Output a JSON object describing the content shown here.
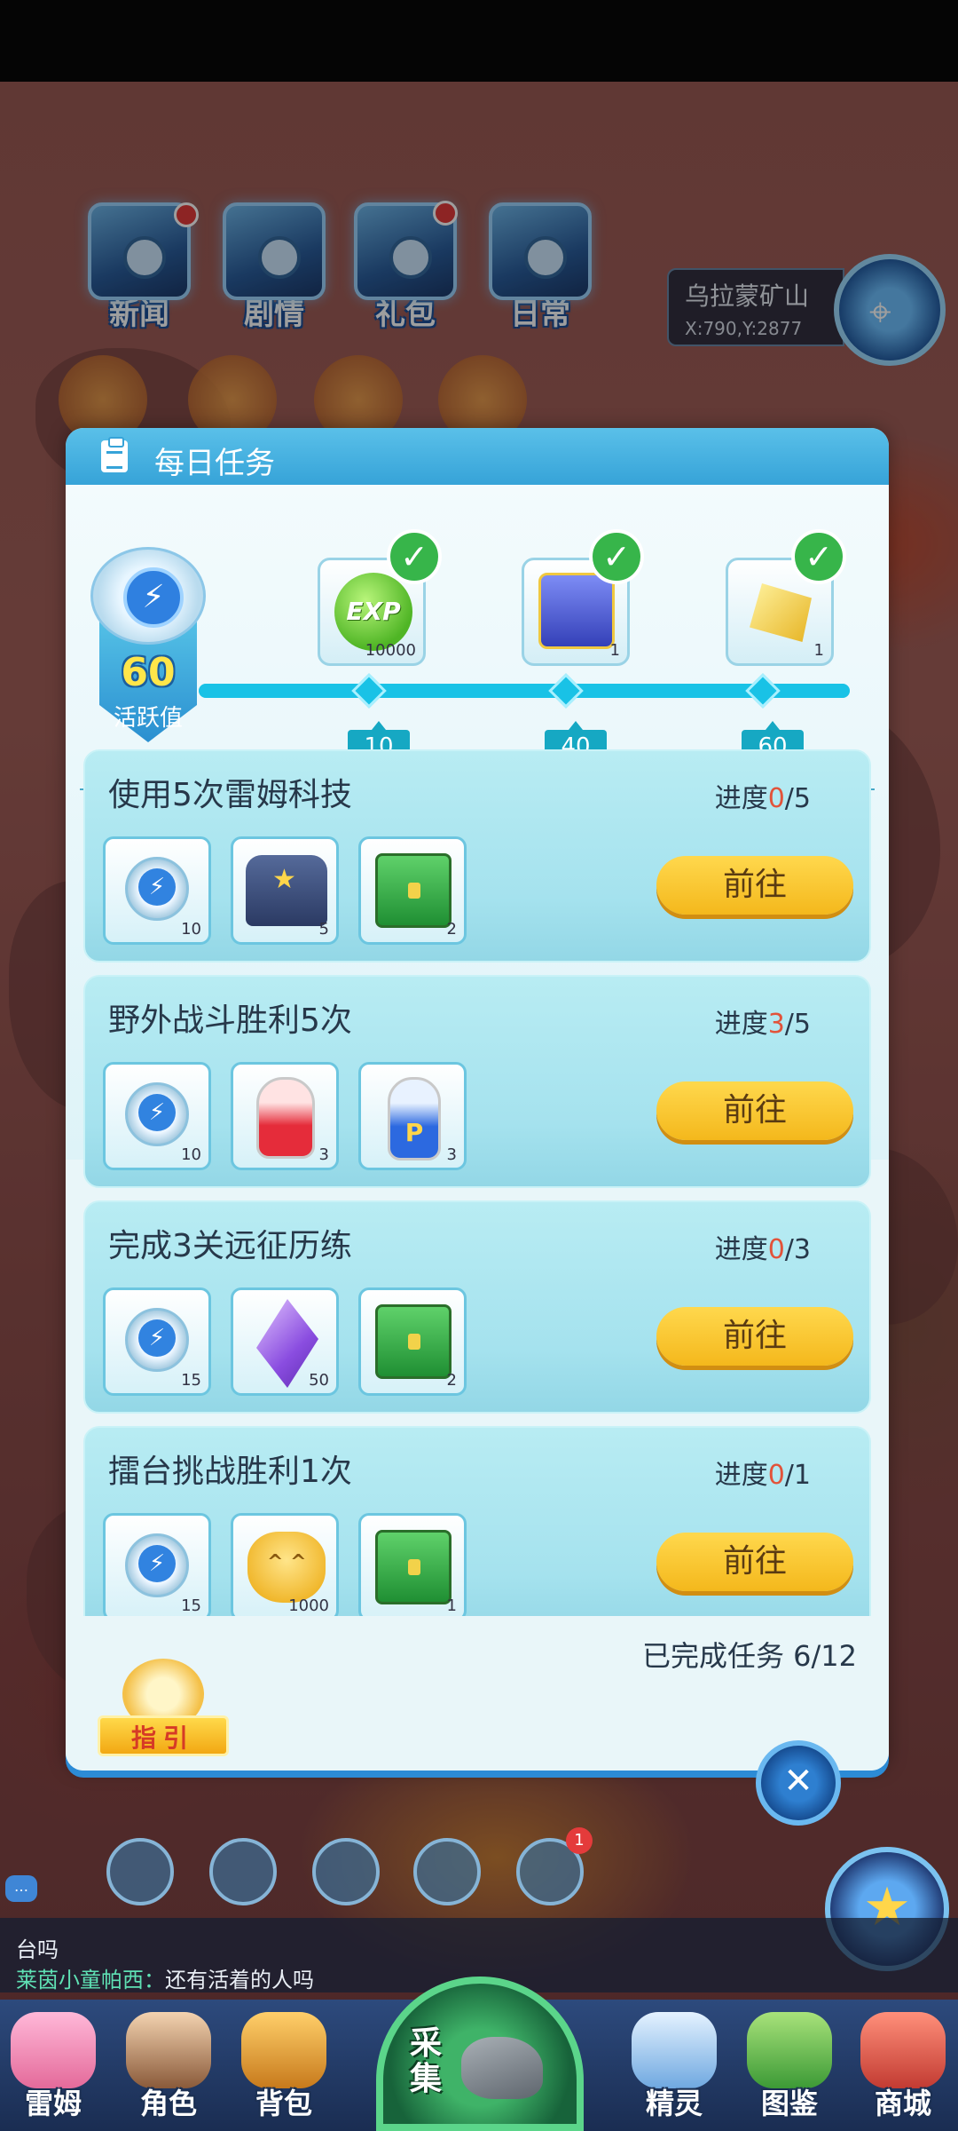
{
  "hud": {
    "icons": [
      {
        "label": "新闻",
        "icon": "news-icon",
        "has_red_dot": true
      },
      {
        "label": "剧情",
        "icon": "story-icon",
        "has_red_dot": false
      },
      {
        "label": "礼包",
        "icon": "gift-pack-icon",
        "has_red_dot": true
      },
      {
        "label": "日常",
        "icon": "daily-icon",
        "has_red_dot": false
      }
    ],
    "location": {
      "name": "乌拉蒙矿山",
      "coord": "X:790,Y:2877"
    }
  },
  "dialog": {
    "title": "每日任务",
    "activity": {
      "value": "60",
      "label": "活跃值",
      "progress_fraction": 1.0,
      "milestones": [
        {
          "threshold": "10",
          "reward": "exp-orb-icon",
          "count": "10000",
          "claimed": true
        },
        {
          "threshold": "40",
          "reward": "blue-chest-icon",
          "count": "1",
          "claimed": true
        },
        {
          "threshold": "60",
          "reward": "gold-crystal-icon",
          "count": "1",
          "claimed": true
        }
      ]
    },
    "tasks": [
      {
        "title": "使用5次雷姆科技",
        "progress_prefix": "进度",
        "current": "0",
        "total": "/5",
        "button": "前往",
        "rewards": [
          {
            "icon": "energy-orb-icon",
            "count": "10"
          },
          {
            "icon": "robot-icon",
            "count": "5"
          },
          {
            "icon": "green-chest-icon",
            "count": "2"
          }
        ]
      },
      {
        "title": "野外战斗胜利5次",
        "progress_prefix": "进度",
        "current": "3",
        "total": "/5",
        "button": "前往",
        "rewards": [
          {
            "icon": "energy-orb-icon",
            "count": "10"
          },
          {
            "icon": "red-potion-icon",
            "count": "3"
          },
          {
            "icon": "blue-potion-icon",
            "count": "3"
          }
        ]
      },
      {
        "title": "完成3关远征历练",
        "progress_prefix": "进度",
        "current": "0",
        "total": "/3",
        "button": "前往",
        "rewards": [
          {
            "icon": "energy-orb-icon",
            "count": "15"
          },
          {
            "icon": "purple-crystal-icon",
            "count": "50"
          },
          {
            "icon": "green-chest-icon",
            "count": "2"
          }
        ]
      },
      {
        "title": "擂台挑战胜利1次",
        "progress_prefix": "进度",
        "current": "0",
        "total": "/1",
        "button": "前往",
        "rewards": [
          {
            "icon": "energy-orb-icon",
            "count": "15"
          },
          {
            "icon": "cat-coin-icon",
            "count": "1000"
          },
          {
            "icon": "green-chest-icon",
            "count": "1"
          }
        ]
      }
    ],
    "completed": "已完成任务 6/12",
    "guide_label": "指引"
  },
  "bottom": {
    "notification_count": "1",
    "chat": {
      "line1": "台吗",
      "speaker": "莱茵小童帕西：",
      "message": "还有活着的人吗"
    },
    "nav": [
      {
        "label": "雷姆",
        "icon": "leim-pet-icon"
      },
      {
        "label": "角色",
        "icon": "character-icon"
      },
      {
        "label": "背包",
        "icon": "backpack-icon"
      },
      {
        "label": "精灵",
        "icon": "spirit-icon"
      },
      {
        "label": "图鉴",
        "icon": "handbook-icon"
      },
      {
        "label": "商城",
        "icon": "shop-icon"
      }
    ],
    "gather_label": "采集"
  },
  "colors": {
    "accent_blue": "#36a3d8",
    "progress_current": "#e2533a",
    "go_button": "#f4b81c",
    "claimed_check": "#37b54a"
  }
}
